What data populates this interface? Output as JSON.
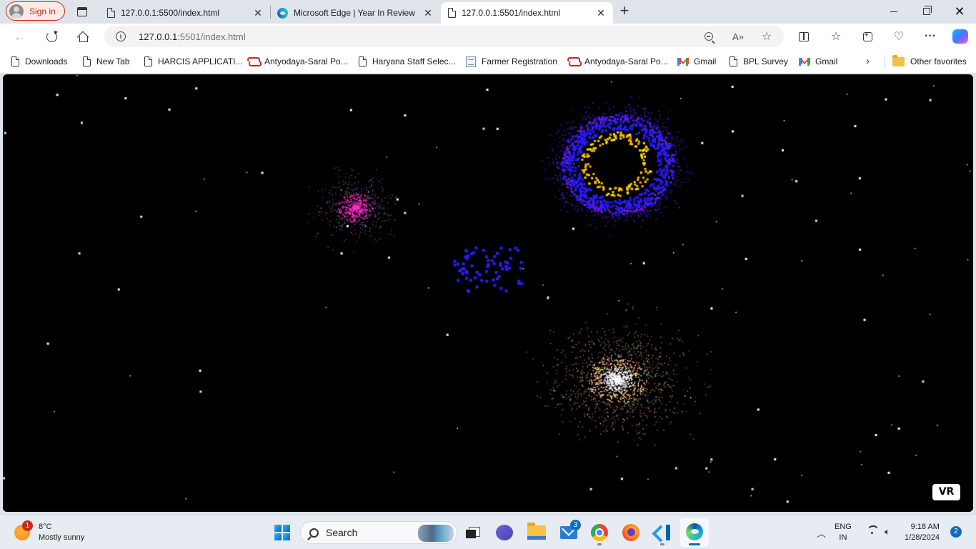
{
  "browser": {
    "profile_label": "Sign in",
    "tabs": [
      {
        "title": "127.0.0.1:5500/index.html",
        "icon": "page-icon",
        "active": false
      },
      {
        "title": "Microsoft Edge | Year In Review",
        "icon": "edge-icon",
        "active": false
      },
      {
        "title": "127.0.0.1:5501/index.html",
        "icon": "page-icon",
        "active": true
      }
    ],
    "new_tab_symbol": "+",
    "close_symbol": "✕",
    "address": {
      "host": "127.0.0.1",
      "rest": ":5501/index.html"
    },
    "favorites": [
      {
        "label": "Downloads",
        "icon": "page-icon"
      },
      {
        "label": "New Tab",
        "icon": "page-icon"
      },
      {
        "label": "HARCIS APPLICATI...",
        "icon": "page-icon"
      },
      {
        "label": "Antyodaya-Saral Po...",
        "icon": "saral-icon"
      },
      {
        "label": "Haryana Staff Selec...",
        "icon": "page-icon"
      },
      {
        "label": "Farmer Registration",
        "icon": "farmer-icon"
      },
      {
        "label": "Antyodaya-Saral Po...",
        "icon": "saral-icon"
      },
      {
        "label": "Gmail",
        "icon": "gmail-icon"
      },
      {
        "label": "BPL Survey",
        "icon": "page-icon"
      },
      {
        "label": "Gmail",
        "icon": "gmail-icon"
      }
    ],
    "other_favorites": "Other favorites"
  },
  "page": {
    "vr_button": "VR",
    "background": "#000000",
    "scene_colors": {
      "magenta": "#ff2fcf",
      "cyan": "#2fd6d6",
      "blue": "#2a1bff",
      "orange": "#ffb000",
      "yellow": "#ffe000",
      "warm": "#ffcc88"
    }
  },
  "taskbar": {
    "weather": {
      "temp": "8°C",
      "condition": "Mostly sunny",
      "badge": "1"
    },
    "search_placeholder": "Search",
    "mail_badge": "3",
    "lang_line1": "ENG",
    "lang_line2": "IN",
    "time": "9:18 AM",
    "date": "1/28/2024",
    "notification_count": "2"
  }
}
